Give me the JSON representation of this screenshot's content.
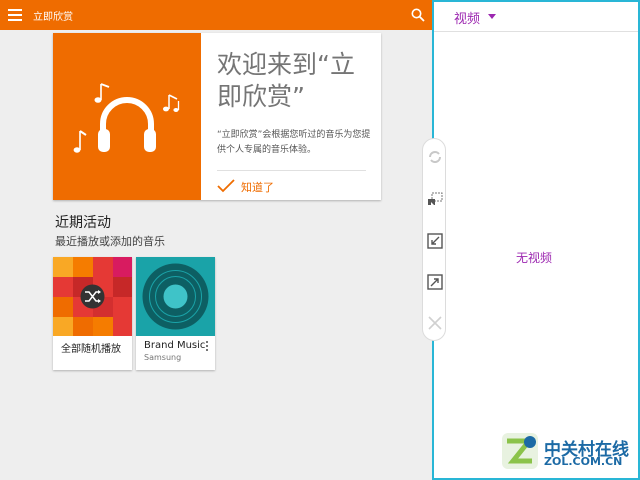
{
  "app": {
    "title": "立即欣赏",
    "accent": "#ef6c00"
  },
  "icons": {
    "menu": "menu-icon",
    "search": "search-icon",
    "headphones": "headphones-icon",
    "music_note": "music-note-icon",
    "check": "check-icon",
    "shuffle": "shuffle-icon",
    "more": "more-vert-icon"
  },
  "welcome_card": {
    "title": "欢迎来到“立即欣赏”",
    "body": "“立即欣赏”会根据您听过的音乐为您提供个人专属的音乐体验。",
    "action_label": "知道了"
  },
  "recent": {
    "title": "近期活动",
    "subtitle": "最近播放或添加的音乐",
    "items": [
      {
        "label": "全部随机播放",
        "sublabel": ""
      },
      {
        "label": "Brand Music",
        "sublabel": "Samsung"
      }
    ]
  },
  "floating_toolbar": {
    "tools": [
      "refresh-icon",
      "screen-capture-icon",
      "minimize-icon",
      "maximize-icon",
      "close-icon"
    ]
  },
  "video_panel": {
    "tab_label": "视频",
    "empty_text": "无视频",
    "accent": "#9c27b0",
    "border": "#29b6d6"
  },
  "watermark": {
    "text": "中关村在线",
    "url": "ZOL.COM.CN"
  }
}
